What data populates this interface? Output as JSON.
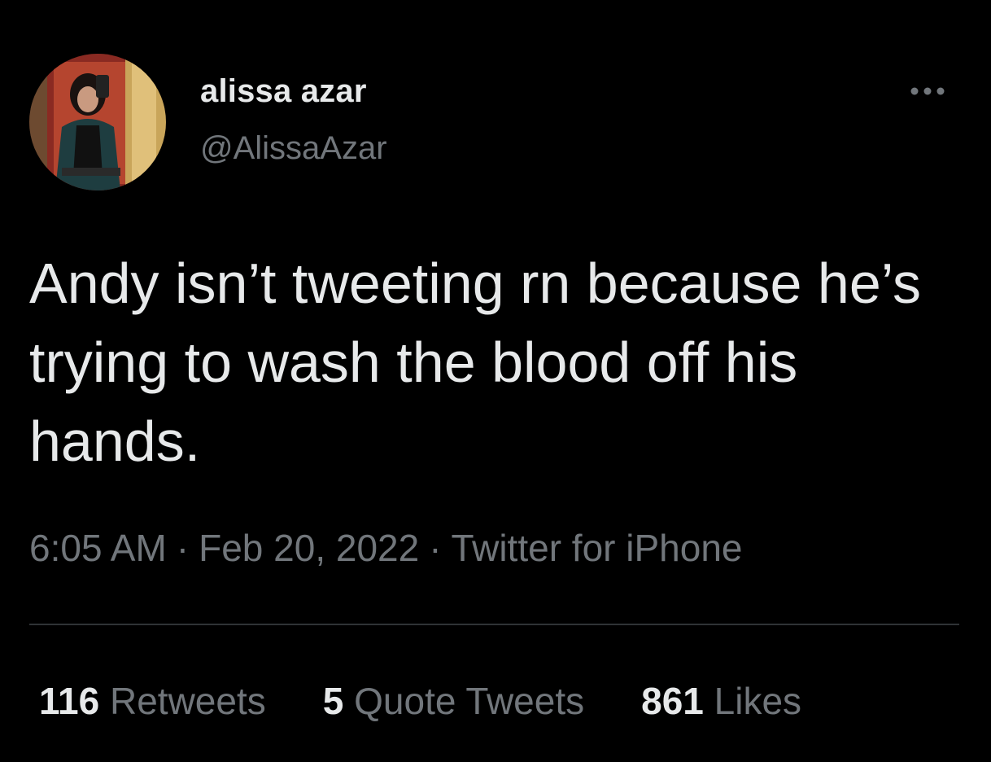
{
  "user": {
    "display_name": "alissa azar",
    "handle": "@AlissaAzar",
    "avatar_icon": "profile-photo"
  },
  "tweet": {
    "text": "Andy isn’t tweeting rn because he’s trying to wash the blood off his hands.",
    "time": "6:05 AM",
    "date": "Feb 20, 2022",
    "source": "Twitter for iPhone",
    "separator": "·"
  },
  "stats": {
    "retweets_count": "116",
    "retweets_label": "Retweets",
    "quotes_count": "5",
    "quotes_label": "Quote Tweets",
    "likes_count": "861",
    "likes_label": "Likes"
  },
  "icons": {
    "more": "more-horizontal-icon"
  },
  "colors": {
    "background": "#000000",
    "primary_text": "#e7e9ea",
    "secondary_text": "#71767b",
    "divider": "#2f3336"
  }
}
